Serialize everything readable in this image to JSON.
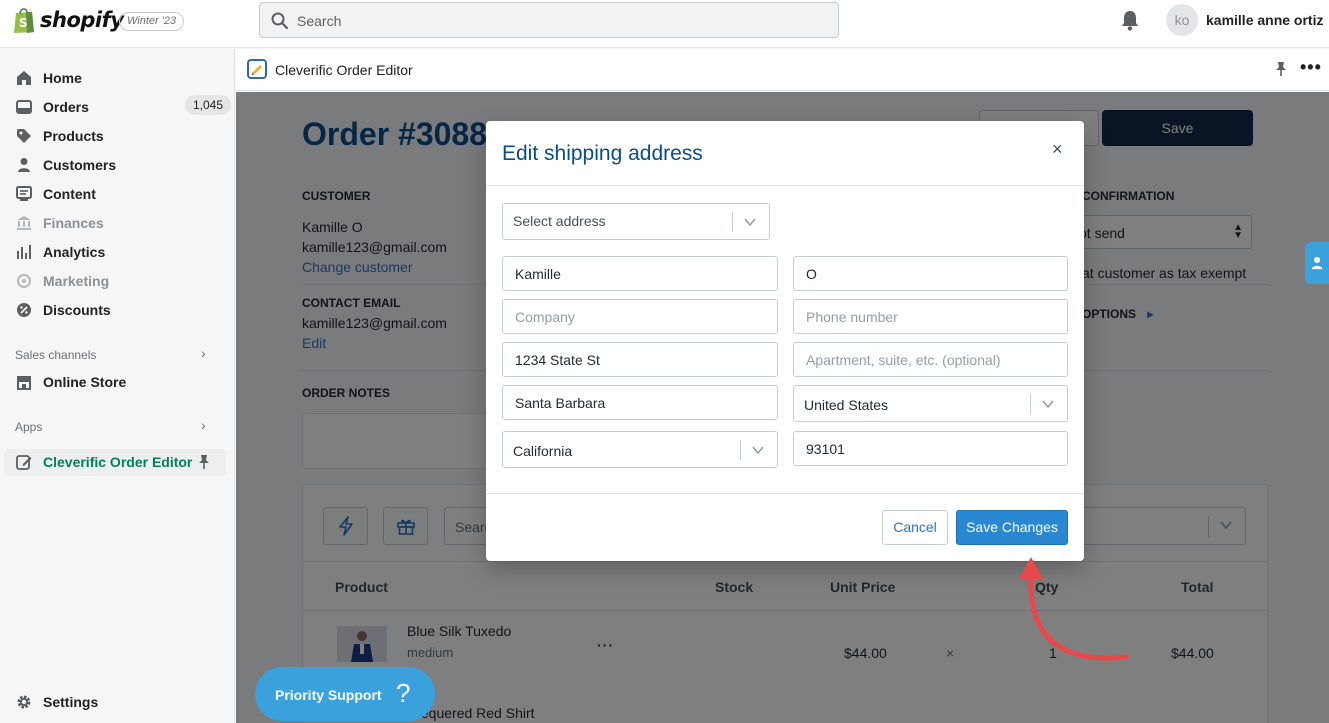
{
  "brand": {
    "name": "shopify",
    "edition": "Winter '23"
  },
  "search": {
    "placeholder": "Search"
  },
  "user": {
    "initials": "ko",
    "name": "kamille anne ortiz"
  },
  "sidebar": {
    "items": [
      {
        "label": "Home",
        "icon": "home-icon"
      },
      {
        "label": "Orders",
        "icon": "orders-icon",
        "badge": "1,045"
      },
      {
        "label": "Products",
        "icon": "tag-icon"
      },
      {
        "label": "Customers",
        "icon": "person-icon"
      },
      {
        "label": "Content",
        "icon": "content-icon"
      },
      {
        "label": "Finances",
        "icon": "finances-icon",
        "disabled": true
      },
      {
        "label": "Analytics",
        "icon": "analytics-icon"
      },
      {
        "label": "Marketing",
        "icon": "marketing-icon",
        "disabled": true
      },
      {
        "label": "Discounts",
        "icon": "discount-icon"
      }
    ],
    "sales_channels_label": "Sales channels",
    "online_store": "Online Store",
    "apps_label": "Apps",
    "active_app": "Cleverific Order Editor",
    "settings": "Settings"
  },
  "app": {
    "title": "Cleverific Order Editor",
    "order_title": "Order #3088",
    "save": "Save",
    "customer_label": "CUSTOMER",
    "customer_name": "Kamille O",
    "customer_email": "kamille123@gmail.com",
    "change_customer": "Change customer",
    "contact_label": "CONTACT EMAIL",
    "contact_email": "kamille123@gmail.com",
    "contact_edit": "Edit",
    "notes_label": "ORDER NOTES",
    "confirmation_label": "CONFIRMATION",
    "confirmation_value": "ot send",
    "tax_exempt": "at customer as tax exempt",
    "options_link": "OPTIONS",
    "product_search": "Searc",
    "columns": {
      "product": "Product",
      "stock": "Stock",
      "unit_price": "Unit Price",
      "qty": "Qty",
      "total": "Total"
    },
    "line_item": {
      "name": "Blue Silk Tuxedo",
      "variant": "medium",
      "price": "$44.00",
      "times": "×",
      "qty": "1",
      "total": "$44.00"
    },
    "next_item": "Chequered Red Shirt",
    "support": "Priority Support",
    "support_q": "?"
  },
  "modal": {
    "title": "Edit shipping address",
    "close": "×",
    "select_address": "Select address",
    "first_name": "Kamille",
    "last_name": "O",
    "company_ph": "Company",
    "phone_ph": "Phone number",
    "address1": "1234 State St",
    "address2_ph": "Apartment, suite, etc. (optional)",
    "city": "Santa Barbara",
    "country": "United States",
    "province": "California",
    "zip": "93101",
    "cancel": "Cancel",
    "save_changes": "Save Changes"
  },
  "colors": {
    "accent": "#2a88d3",
    "title_blue": "#084e8a",
    "annotation_arrow": "#e8474c"
  }
}
